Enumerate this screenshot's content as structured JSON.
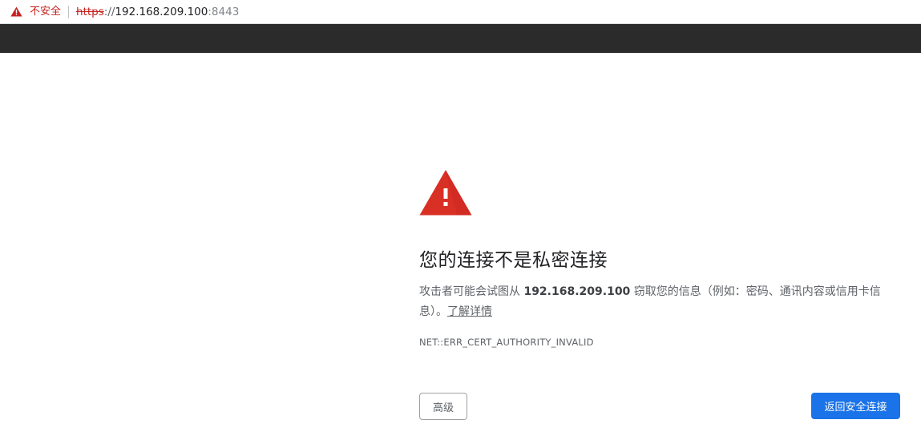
{
  "address_bar": {
    "security_label": "不安全",
    "url": {
      "scheme": "https",
      "separator": "://",
      "host": "192.168.209.100",
      "port": ":8443"
    },
    "icon": "warning-triangle-icon"
  },
  "interstitial": {
    "icon": "large-warning-triangle-icon",
    "heading": "您的连接不是私密连接",
    "explanation_before": "攻击者可能会试图从 ",
    "explanation_host": "192.168.209.100",
    "explanation_after": " 窃取您的信息（例如：密码、通讯内容或信用卡信息）。",
    "learn_more": "了解详情",
    "error_code": "NET::ERR_CERT_AUTHORITY_INVALID"
  },
  "buttons": {
    "advanced": "高级",
    "back_to_safety": "返回安全连接"
  },
  "colors": {
    "danger": "#c5221f",
    "warning_icon": "#d93025",
    "primary_button": "#1a73e8",
    "dark_strip": "#2b2b2b"
  }
}
